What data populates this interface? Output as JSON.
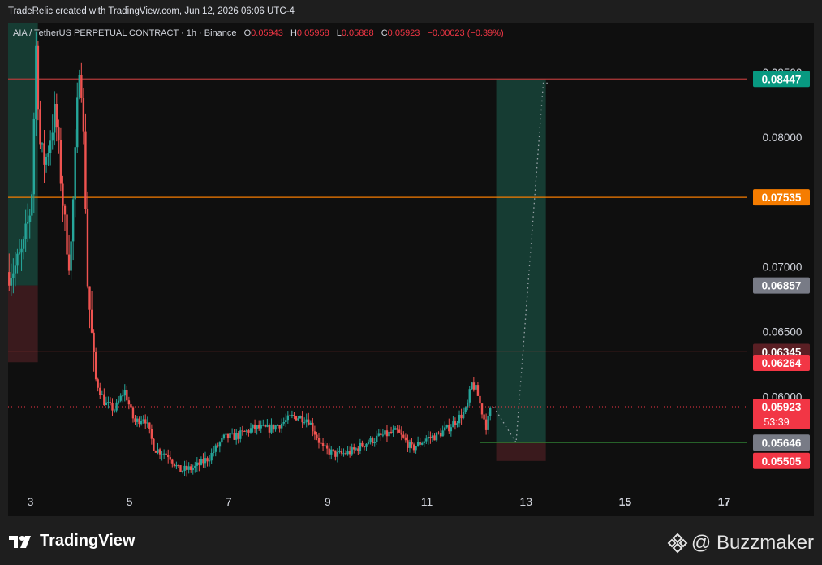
{
  "caption": "TradeRelic created with TradingView.com, Jun 12, 2026 06:06 UTC-4",
  "header": {
    "symbol": "AIA / TetherUS PERPETUAL CONTRACT · 1h · Binance",
    "o_label": "O",
    "o_value": "0.05943",
    "h_label": "H",
    "h_value": "0.05958",
    "l_label": "L",
    "l_value": "0.05888",
    "c_label": "C",
    "c_value": "0.05923",
    "change": "−0.00023 (−0.39%)"
  },
  "footer": {
    "brand": "TradingView",
    "watermark": "@ Buzzmaker",
    "brand_icon": "tradingview-logo-icon",
    "watermark_icon": "binance-diamond-icon"
  },
  "colors": {
    "bull": "#26a69a",
    "bear": "#ef5350",
    "target_zone": "#163c33",
    "stop_zone": "#3a1a1d",
    "resistance_line": "#b23a3a",
    "orange_line": "#f57c00",
    "support_line": "#2e7d32"
  },
  "chart_data": {
    "type": "candlestick",
    "x_ticks": [
      "3",
      "5",
      "7",
      "9",
      "11",
      "13",
      "15",
      "17"
    ],
    "x_tick_values": [
      3,
      5,
      7,
      9,
      11,
      13,
      15,
      17
    ],
    "xlim": [
      2.55,
      17.45
    ],
    "ylim": [
      0.05285,
      0.0888
    ],
    "y_ticks": [
      {
        "value": 0.085,
        "label": "0.08500"
      },
      {
        "value": 0.08,
        "label": "0.08000"
      },
      {
        "value": 0.07,
        "label": "0.07000"
      },
      {
        "value": 0.065,
        "label": "0.06500"
      },
      {
        "value": 0.06,
        "label": "0.06000"
      }
    ],
    "path": [
      [
        2.55,
        0.0696
      ],
      [
        2.7,
        0.07
      ],
      [
        2.85,
        0.0712
      ],
      [
        3.0,
        0.0745
      ],
      [
        3.05,
        0.077
      ],
      [
        3.1,
        0.088
      ],
      [
        3.2,
        0.079
      ],
      [
        3.3,
        0.078
      ],
      [
        3.5,
        0.082
      ],
      [
        3.7,
        0.073
      ],
      [
        3.8,
        0.07
      ],
      [
        3.9,
        0.078
      ],
      [
        4.0,
        0.087
      ],
      [
        4.1,
        0.077
      ],
      [
        4.15,
        0.069
      ],
      [
        4.25,
        0.064
      ],
      [
        4.3,
        0.0615
      ],
      [
        4.5,
        0.0595
      ],
      [
        4.7,
        0.059
      ],
      [
        4.9,
        0.0605
      ],
      [
        5.1,
        0.058
      ],
      [
        5.3,
        0.0585
      ],
      [
        5.5,
        0.056
      ],
      [
        5.8,
        0.0555
      ],
      [
        6.0,
        0.0543
      ],
      [
        6.3,
        0.0545
      ],
      [
        6.6,
        0.0553
      ],
      [
        6.9,
        0.0568
      ],
      [
        7.2,
        0.057
      ],
      [
        7.5,
        0.0576
      ],
      [
        7.8,
        0.0575
      ],
      [
        8.1,
        0.058
      ],
      [
        8.3,
        0.0585
      ],
      [
        8.6,
        0.0583
      ],
      [
        8.9,
        0.056
      ],
      [
        9.2,
        0.0555
      ],
      [
        9.5,
        0.0558
      ],
      [
        9.8,
        0.0565
      ],
      [
        10.1,
        0.057
      ],
      [
        10.4,
        0.0573
      ],
      [
        10.7,
        0.056
      ],
      [
        11.0,
        0.0568
      ],
      [
        11.2,
        0.057
      ],
      [
        11.4,
        0.0575
      ],
      [
        11.6,
        0.0582
      ],
      [
        11.8,
        0.059
      ],
      [
        11.9,
        0.061
      ],
      [
        12.0,
        0.0605
      ],
      [
        12.1,
        0.059
      ],
      [
        12.2,
        0.0577
      ],
      [
        12.3,
        0.0592
      ]
    ],
    "projection_path": [
      [
        12.35,
        0.0592
      ],
      [
        12.8,
        0.05646
      ],
      [
        13.35,
        0.0842
      ],
      [
        13.5,
        0.0841
      ]
    ],
    "position": {
      "x_start": 12.4,
      "x_end": 13.4,
      "target": 0.08447,
      "entry": 0.05646,
      "stop": 0.05505,
      "early_x_start": 2.55,
      "early_x_end": 3.15,
      "early_top": 0.0888,
      "early_mid": 0.06857,
      "early_bottom": 0.06265
    },
    "levels": [
      {
        "value": 0.08447,
        "label": "0.08447",
        "color": "#b23a3a",
        "badge": "#089981"
      },
      {
        "value": 0.07535,
        "label": "0.07535",
        "color": "#f57c00",
        "badge": "#f57c00"
      },
      {
        "value": 0.06857,
        "label": "0.06857",
        "color": null,
        "badge": "#787b86"
      },
      {
        "value": 0.06345,
        "label": "0.06345",
        "color": "#b23a3a",
        "badge": "#5a1f24"
      },
      {
        "value": 0.0626,
        "label": "0.06264",
        "color": null,
        "badge": "#f23645"
      },
      {
        "value": 0.05923,
        "label": "0.05923",
        "color": "#f23645",
        "badge": "#f23645",
        "sub": "53:39"
      },
      {
        "value": 0.05646,
        "label": "0.05646",
        "color": "#2e7d32",
        "badge": "#787b86"
      },
      {
        "value": 0.05505,
        "label": "0.05505",
        "color": null,
        "badge": "#f23645"
      }
    ]
  }
}
